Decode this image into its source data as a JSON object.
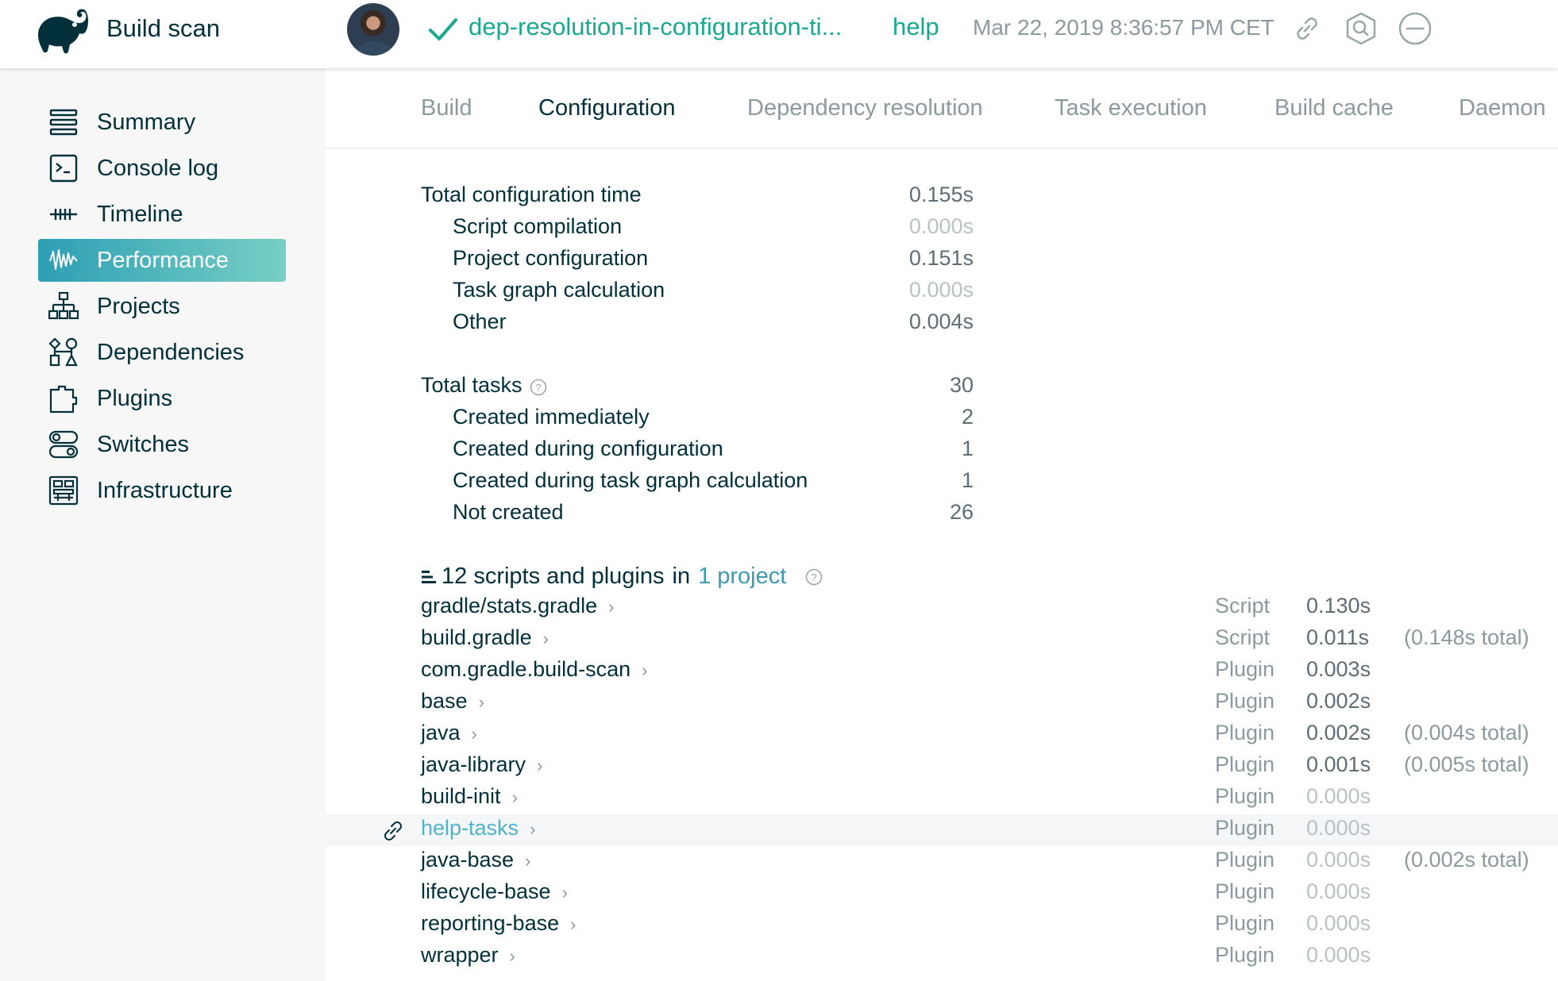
{
  "header": {
    "app_title": "Build scan",
    "build_name": "dep-resolution-in-configuration-ti...",
    "build_task": "help",
    "build_date": "Mar 22, 2019 8:36:57 PM CET",
    "status_color": "#1ba890",
    "icons": [
      "gradle-elephant-logo",
      "avatar",
      "success-check-icon",
      "link-icon",
      "search-icon",
      "minus-circle-icon"
    ]
  },
  "sidebar": {
    "items": [
      {
        "label": "Summary",
        "icon": "summary-icon"
      },
      {
        "label": "Console log",
        "icon": "console-icon"
      },
      {
        "label": "Timeline",
        "icon": "timeline-icon"
      },
      {
        "label": "Performance",
        "icon": "performance-icon",
        "active": true
      },
      {
        "label": "Projects",
        "icon": "projects-icon"
      },
      {
        "label": "Dependencies",
        "icon": "dependencies-icon"
      },
      {
        "label": "Plugins",
        "icon": "plugins-icon"
      },
      {
        "label": "Switches",
        "icon": "switches-icon"
      },
      {
        "label": "Infrastructure",
        "icon": "infrastructure-icon"
      }
    ],
    "active_color": "#3aa6b9"
  },
  "tabs": [
    "Build",
    "Configuration",
    "Dependency resolution",
    "Task execution",
    "Build cache",
    "Daemon"
  ],
  "active_tab": "Configuration",
  "configuration": {
    "total_label": "Total configuration time",
    "total_value": "0.155s",
    "breakdown": [
      {
        "label": "Script compilation",
        "value": "0.000s"
      },
      {
        "label": "Project configuration",
        "value": "0.151s"
      },
      {
        "label": "Task graph calculation",
        "value": "0.000s"
      },
      {
        "label": "Other",
        "value": "0.004s"
      }
    ]
  },
  "tasks": {
    "total_label": "Total tasks",
    "total_value": "30",
    "breakdown": [
      {
        "label": "Created immediately",
        "value": "2"
      },
      {
        "label": "Created during configuration",
        "value": "1"
      },
      {
        "label": "Created during task graph calculation",
        "value": "1"
      },
      {
        "label": "Not created",
        "value": "26"
      }
    ]
  },
  "scripts": {
    "heading": "12 scripts and plugins",
    "heading_in": "in",
    "project_link": "1 project",
    "rows": [
      {
        "name": "gradle/stats.gradle",
        "type": "Script",
        "time": "0.130s",
        "total": ""
      },
      {
        "name": "build.gradle",
        "type": "Script",
        "time": "0.011s",
        "total": "(0.148s total)"
      },
      {
        "name": "com.gradle.build-scan",
        "type": "Plugin",
        "time": "0.003s",
        "total": ""
      },
      {
        "name": "base",
        "type": "Plugin",
        "time": "0.002s",
        "total": ""
      },
      {
        "name": "java",
        "type": "Plugin",
        "time": "0.002s",
        "total": "(0.004s total)"
      },
      {
        "name": "java-library",
        "type": "Plugin",
        "time": "0.001s",
        "total": "(0.005s total)"
      },
      {
        "name": "build-init",
        "type": "Plugin",
        "time": "0.000s",
        "total": ""
      },
      {
        "name": "help-tasks",
        "type": "Plugin",
        "time": "0.000s",
        "total": "",
        "highlighted": true
      },
      {
        "name": "java-base",
        "type": "Plugin",
        "time": "0.000s",
        "total": "(0.002s total)"
      },
      {
        "name": "lifecycle-base",
        "type": "Plugin",
        "time": "0.000s",
        "total": ""
      },
      {
        "name": "reporting-base",
        "type": "Plugin",
        "time": "0.000s",
        "total": ""
      },
      {
        "name": "wrapper",
        "type": "Plugin",
        "time": "0.000s",
        "total": ""
      }
    ]
  }
}
